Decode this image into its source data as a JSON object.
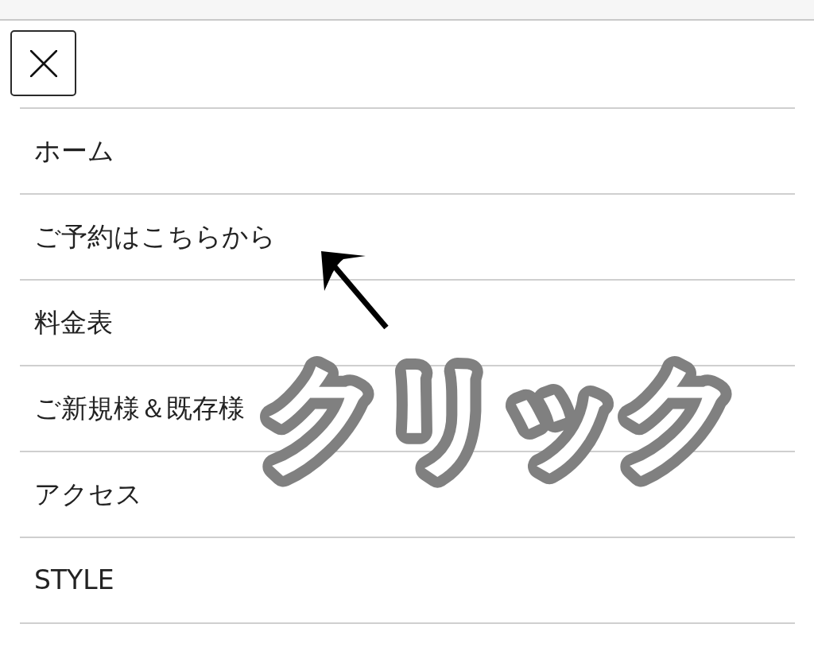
{
  "menu": {
    "items": [
      {
        "label": "ホーム"
      },
      {
        "label": "ご予約はこちらから"
      },
      {
        "label": "料金表"
      },
      {
        "label": "ご新規様＆既存様"
      },
      {
        "label": "アクセス"
      },
      {
        "label": "STYLE"
      }
    ]
  },
  "overlay": {
    "text": "クリック"
  }
}
